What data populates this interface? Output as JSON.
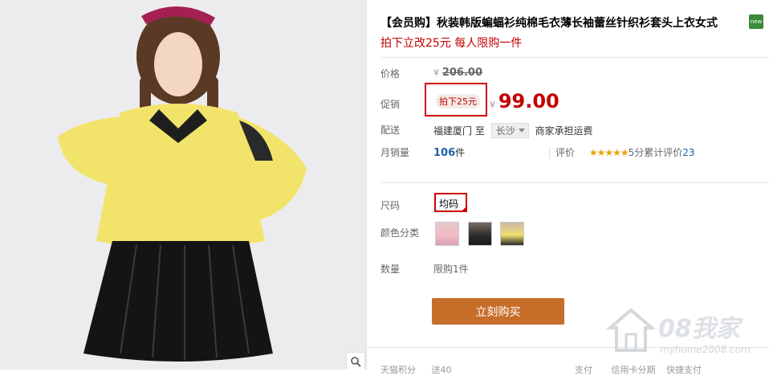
{
  "product": {
    "title": "【会员购】秋装韩版蝙蝠衫纯棉毛衣薄长袖蕾丝针织衫套头上衣女式",
    "new_badge": "new",
    "subtitle": "拍下立改25元 每人限购一件"
  },
  "price": {
    "label": "价格",
    "currency": "¥",
    "original": "206.00"
  },
  "promo": {
    "label": "促销",
    "tag": "拍下25元",
    "currency": "¥",
    "price": "99.00"
  },
  "shipping": {
    "label": "配送",
    "from": "福建厦门",
    "to_word": "至",
    "destination": "长沙",
    "fee_note": "商家承担运费"
  },
  "sales": {
    "label": "月销量",
    "count": "106",
    "unit": "件",
    "rating_label": "评价",
    "stars": "★★★★★",
    "rating_text": "5分累计评价",
    "rating_count": "23"
  },
  "options": {
    "size_label": "尺码",
    "size_value": "均码",
    "color_label": "颜色分类",
    "colors": [
      "pink-collar",
      "black-top",
      "yellow-top"
    ]
  },
  "quantity": {
    "label": "数量",
    "limit": "限购1件"
  },
  "buy_button": "立刻购买",
  "bottom": {
    "left": "天猫积分",
    "mid": "送40",
    "right": "支付",
    "right2": "信用卡分期",
    "right3": "快捷支付"
  },
  "watermark": {
    "big": "08我家",
    "url": "myhome2008.com"
  },
  "colors": {
    "price_red": "#c40000",
    "buy_button": "#c66e2a",
    "link_blue": "#1e5fa8",
    "highlight_box": "#d00000"
  }
}
